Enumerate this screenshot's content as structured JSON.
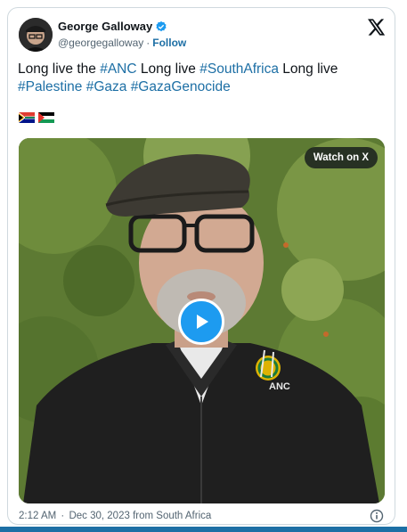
{
  "author": {
    "name": "George Galloway",
    "handle": "@georgegalloway",
    "separator": "·",
    "follow_label": "Follow"
  },
  "tweet": {
    "segments": [
      {
        "text": "Long live the ",
        "type": "text"
      },
      {
        "text": "#ANC",
        "type": "hashtag"
      },
      {
        "text": " Long live ",
        "type": "text"
      },
      {
        "text": "#SouthAfrica",
        "type": "hashtag"
      },
      {
        "text": " Long live ",
        "type": "text"
      },
      {
        "text": "#Palestine",
        "type": "hashtag"
      },
      {
        "text": " ",
        "type": "text"
      },
      {
        "text": "#Gaza",
        "type": "hashtag"
      },
      {
        "text": " ",
        "type": "text"
      },
      {
        "text": "#GazaGenocide",
        "type": "hashtag"
      }
    ],
    "flags": [
      "south-africa-flag",
      "palestine-flag"
    ]
  },
  "media": {
    "watch_label": "Watch on X",
    "logo_text": "ANC"
  },
  "footer": {
    "time": "2:12 AM",
    "separator": "·",
    "date": "Dec 30, 2023",
    "location": "from South Africa"
  },
  "colors": {
    "link": "#1d6fa5",
    "play": "#1d9bf0",
    "text": "#0f1419",
    "muted": "#536471"
  },
  "icons": [
    "verified-badge-icon",
    "x-logo-icon",
    "play-icon",
    "info-icon"
  ]
}
